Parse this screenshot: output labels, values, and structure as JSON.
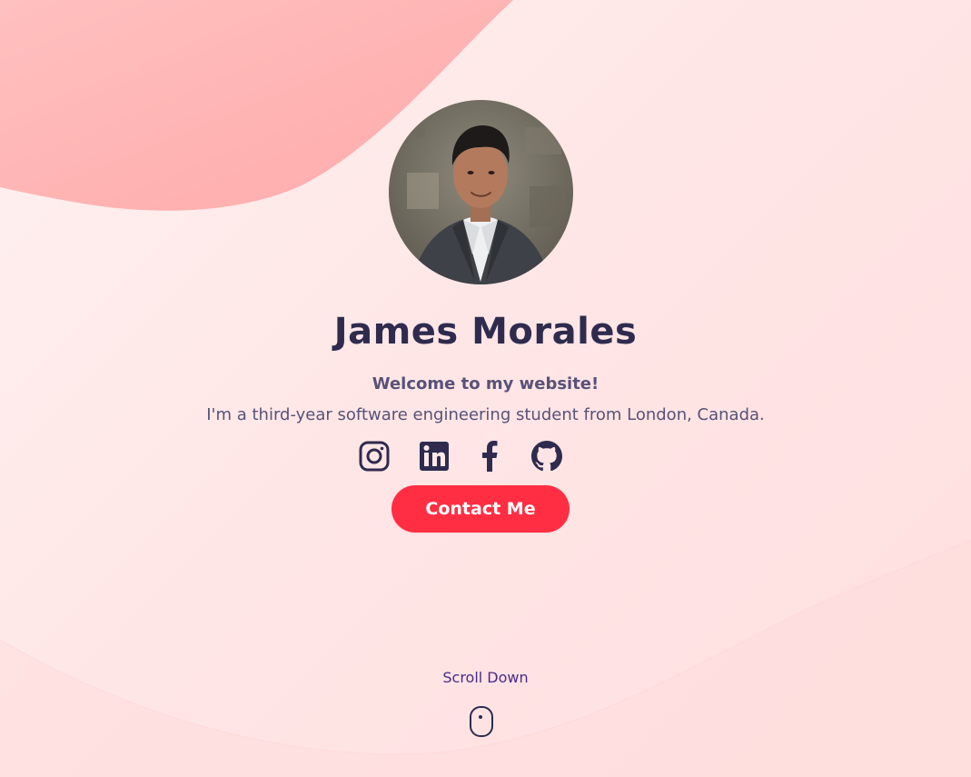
{
  "profile": {
    "name": "James Morales",
    "welcome": "Welcome to my website!",
    "tagline": "I'm a third-year software engineering student from London, Canada.",
    "avatar_alt": "Portrait photo"
  },
  "socials": [
    {
      "name": "instagram",
      "icon": "instagram-icon"
    },
    {
      "name": "linkedin",
      "icon": "linkedin-icon"
    },
    {
      "name": "facebook",
      "icon": "facebook-icon"
    },
    {
      "name": "github",
      "icon": "github-icon"
    }
  ],
  "cta": {
    "label": "Contact Me"
  },
  "scroll": {
    "label": "Scroll Down",
    "icon": "mouse-icon"
  },
  "colors": {
    "accent": "#ff2e43",
    "heading": "#2e2b4f",
    "body_text": "#585277",
    "scroll_text": "#4b2a86",
    "blob": "#ffb3b3",
    "background": "#ffeaea"
  }
}
